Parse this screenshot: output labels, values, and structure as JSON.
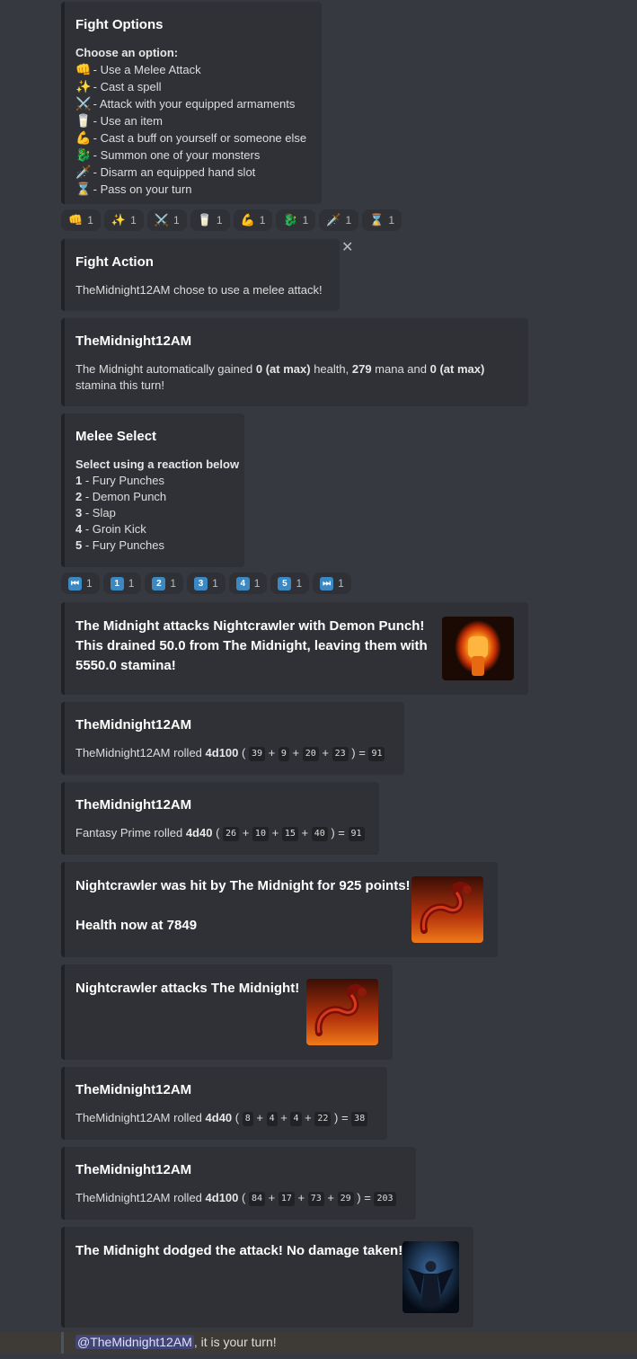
{
  "fight_options": {
    "title": "Fight Options",
    "subtitle": "Choose an option:",
    "items": [
      {
        "icon": "👊",
        "icon_name": "punch-icon",
        "label": "- Use a Melee Attack"
      },
      {
        "icon": "✨",
        "icon_name": "sparkles-icon",
        "label": "- Cast a spell"
      },
      {
        "icon": "⚔️",
        "icon_name": "crossed-swords-icon",
        "label": "- Attack with your equipped armaments"
      },
      {
        "icon": "🥛",
        "icon_name": "glass-icon",
        "label": "- Use an item"
      },
      {
        "icon": "💪",
        "icon_name": "flexed-bicep-icon",
        "label": "- Cast a buff on yourself or someone else"
      },
      {
        "icon": "🐉",
        "icon_name": "dragon-icon",
        "label": "- Summon one of your monsters"
      },
      {
        "icon": "🗡️",
        "icon_name": "dagger-icon",
        "label": "- Disarm an equipped hand slot"
      },
      {
        "icon": "⌛",
        "icon_name": "hourglass-icon",
        "label": "- Pass on your turn"
      }
    ]
  },
  "fight_reactions": [
    {
      "icon": "👊",
      "count": "1"
    },
    {
      "icon": "✨",
      "count": "1"
    },
    {
      "icon": "⚔️",
      "count": "1"
    },
    {
      "icon": "🥛",
      "count": "1"
    },
    {
      "icon": "💪",
      "count": "1"
    },
    {
      "icon": "🐉",
      "count": "1"
    },
    {
      "icon": "🗡️",
      "count": "1"
    },
    {
      "icon": "⌛",
      "count": "1"
    }
  ],
  "fight_action": {
    "title": "Fight Action",
    "desc": "TheMidnight12AM chose to use a melee attack!"
  },
  "regen": {
    "title": "TheMidnight12AM",
    "p1": "The Midnight automatically gained ",
    "b1": "0 (at max)",
    "p2": " health, ",
    "b2": "279",
    "p3": " mana and ",
    "b3": "0 (at max)",
    "p4": "stamina this turn!"
  },
  "melee_select": {
    "title": "Melee Select",
    "subtitle": "Select using a reaction below",
    "items": [
      {
        "num": "1",
        "label": " - Fury Punches"
      },
      {
        "num": "2",
        "label": " - Demon Punch"
      },
      {
        "num": "3",
        "label": " - Slap"
      },
      {
        "num": "4",
        "label": " - Groin Kick"
      },
      {
        "num": "5",
        "label": " - Fury Punches"
      }
    ]
  },
  "melee_reactions": [
    {
      "icon": "⏮",
      "count": "1"
    },
    {
      "icon": "1",
      "count": "1"
    },
    {
      "icon": "2",
      "count": "1"
    },
    {
      "icon": "3",
      "count": "1"
    },
    {
      "icon": "4",
      "count": "1"
    },
    {
      "icon": "5",
      "count": "1"
    },
    {
      "icon": "⏭",
      "count": "1"
    }
  ],
  "demon_punch": {
    "line1": "The Midnight attacks Nightcrawler with Demon Punch!",
    "line2": "This drained 50.0 from The Midnight, leaving them with",
    "line3": "5550.0 stamina!"
  },
  "roll1": {
    "title": "TheMidnight12AM",
    "prefix": "TheMidnight12AM rolled ",
    "dice": "4d100",
    "open": " ( ",
    "v": [
      "39",
      "9",
      "20",
      "23"
    ],
    "close": " ) = ",
    "total": "91"
  },
  "roll2": {
    "title": "TheMidnight12AM",
    "prefix": "Fantasy Prime rolled ",
    "dice": "4d40",
    "open": " ( ",
    "v": [
      "26",
      "10",
      "15",
      "40"
    ],
    "close": " ) = ",
    "total": "91"
  },
  "hit": {
    "line1": "Nightcrawler was hit by The Midnight for 925 points!",
    "line2": "Health now at 7849"
  },
  "counter": {
    "line1": "Nightcrawler attacks The Midnight!"
  },
  "roll3": {
    "title": "TheMidnight12AM",
    "prefix": "TheMidnight12AM rolled ",
    "dice": "4d40",
    "open": " ( ",
    "v": [
      "8",
      "4",
      "4",
      "22"
    ],
    "close": " ) = ",
    "total": "38"
  },
  "roll4": {
    "title": "TheMidnight12AM",
    "prefix": "TheMidnight12AM rolled ",
    "dice": "4d100",
    "open": " ( ",
    "v": [
      "84",
      "17",
      "73",
      "29"
    ],
    "close": " ) = ",
    "total": "203"
  },
  "dodge": {
    "line1": "The Midnight dodged the attack! No damage taken!"
  },
  "mention": {
    "user": "@TheMidnight12AM",
    "text": ", it is your turn!"
  },
  "plus": "+",
  "close_icon": "✕"
}
